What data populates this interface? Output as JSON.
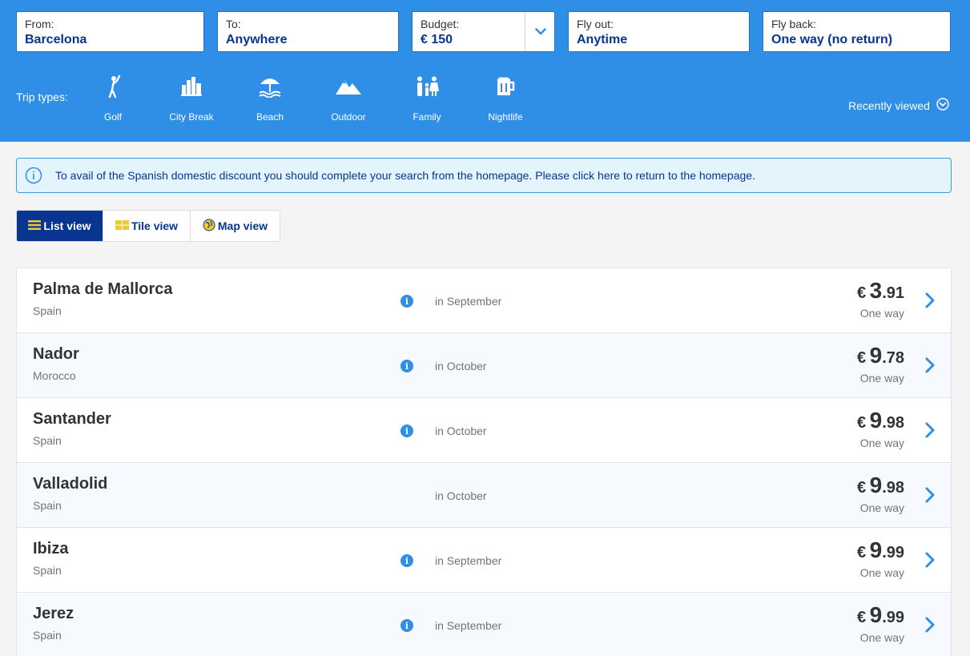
{
  "search": {
    "from": {
      "label": "From:",
      "value": "Barcelona"
    },
    "to": {
      "label": "To:",
      "value": "Anywhere"
    },
    "budget": {
      "label": "Budget:",
      "value": "€ 150"
    },
    "fly_out": {
      "label": "Fly out:",
      "value": "Anytime"
    },
    "fly_back": {
      "label": "Fly back:",
      "value": "One way (no return)"
    }
  },
  "trip_types": {
    "label": "Trip types:",
    "items": [
      {
        "name": "Golf",
        "icon": "golf-icon"
      },
      {
        "name": "City Break",
        "icon": "city-icon"
      },
      {
        "name": "Beach",
        "icon": "beach-icon"
      },
      {
        "name": "Outdoor",
        "icon": "mountain-icon"
      },
      {
        "name": "Family",
        "icon": "family-icon"
      },
      {
        "name": "Nightlife",
        "icon": "beer-icon"
      }
    ]
  },
  "recently_viewed": "Recently viewed",
  "banner": {
    "text": "To avail of the Spanish domestic discount you should complete your search from the homepage. Please click here to return to the homepage."
  },
  "views": {
    "list": "List view",
    "tile": "Tile view",
    "map": "Map view",
    "active": "list"
  },
  "results": [
    {
      "city": "Palma de Mallorca",
      "country": "Spain",
      "when": "in September",
      "currency": "€",
      "int": "3",
      "dec": ".91",
      "trip": "One way",
      "has_info": true
    },
    {
      "city": "Nador",
      "country": "Morocco",
      "when": "in October",
      "currency": "€",
      "int": "9",
      "dec": ".78",
      "trip": "One way",
      "has_info": true
    },
    {
      "city": "Santander",
      "country": "Spain",
      "when": "in October",
      "currency": "€",
      "int": "9",
      "dec": ".98",
      "trip": "One way",
      "has_info": true
    },
    {
      "city": "Valladolid",
      "country": "Spain",
      "when": "in October",
      "currency": "€",
      "int": "9",
      "dec": ".98",
      "trip": "One way",
      "has_info": false
    },
    {
      "city": "Ibiza",
      "country": "Spain",
      "when": "in September",
      "currency": "€",
      "int": "9",
      "dec": ".99",
      "trip": "One way",
      "has_info": true
    },
    {
      "city": "Jerez",
      "country": "Spain",
      "when": "in September",
      "currency": "€",
      "int": "9",
      "dec": ".99",
      "trip": "One way",
      "has_info": true
    }
  ],
  "colors": {
    "header_bg": "#2f8ee5",
    "navy": "#073590",
    "accent_yellow": "#f1c933"
  }
}
